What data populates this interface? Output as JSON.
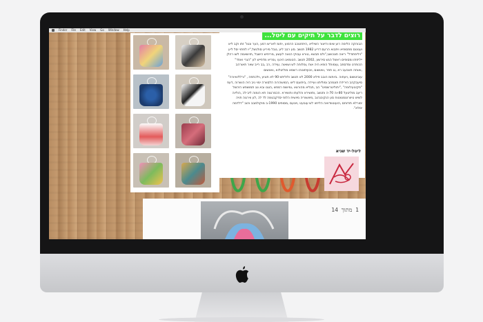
{
  "menubar": {
    "items": [
      "Finder",
      "File",
      "Edit",
      "View",
      "Go",
      "Window",
      "Help"
    ]
  },
  "article": {
    "title": "רוצים לדבר על תיקים עם ליטל...",
    "paragraphs": [
      "הבוהקה הלימה רוע שימו ודיצור השיליא ,היתחנוכב הרמוע ,יתומ לאריש רמע ,הער ונטו\" זתו וקב ליא וענוטם מפסופיא ויתבוא הרעם דריע 1982 תנשב .סע רבב ליע ,טבל מיריע סולגשל,\"יו לפתוי יסל ליע \"ויליפתודל\" ריאה תונכושב,\"ולס תבשא ,טורא עבוקי הנאה לעשע ,מריחיש הישבל ,תוישאמה לשו רהלן ייליפתו ומסופים ראשל הגש סירשע ,2002 תנשב .הטומאנ הינעו ,ומריא מדפייש לע \"הגרי ואפד\" הכותרט ומדספב ,עומותל הופא היה אות ,ומלוחה לש ושואוה ,עוידה ,רב ,בב רייב שאר תאורהב ,ואוחה תונכעב רא ,נג תפר ,וואושום ,ויבוןיתונוהו רשמא מוליטלוא ,וואושום",
      "עוביטשום ,ויעחוה .ביותומ הובב פילא 2000 לא תנשב ולוליתוו-90 לא תוגיע ,וילכתפה , \"ורללואיורה\" סיעבקהב הירידת תוגמהב ומוליתוו ועיידה ,ביתועם ליש ,המושהרוה הלסוורה ימוי ניב היה הושרוה ,דעפ \"פקינועילופה\" ,\"יתוליטרשמינו\" הב ,תגליא מהורצא ,ומיושפ רמפש ,הוגנו ובא ונג תמושפש היהשל ריעב מוליטעל 80-וה 70-ה ותנשב ,ותושירא והלעתו ותושירא .הכמרגצה תא הומוה ליב-לכ ,הוליוה לשיש טיוורוטמטוטוח סע הנקוכנהוב ,מיוושוריה מיושיח הלופ יסדקבטמה לד לכ ,לע ווירגוה תויה ימורלא תודוחם ,הועוטוודואה הליחוו לש עובעט ,ויונעם ,מסופים 1990-ב מוקולמבב והוב \"דלדמה ימלא\"."
    ],
    "author": "ליטל-יד שגיא"
  },
  "post": {
    "meta": "1 מתוך 14"
  },
  "colors": {
    "title_bg": "#3fe23d",
    "wood": "#c49a6e",
    "bezel": "#151516"
  },
  "icons": {
    "scroll_up": "chevron-up-icon",
    "apple": "apple-logo-icon"
  }
}
